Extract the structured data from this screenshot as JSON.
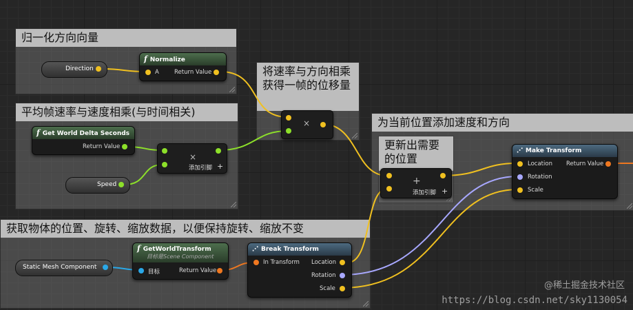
{
  "comments": {
    "normalize": "归一化方向向量",
    "delta": "平均帧速率与速度相乘(与时间相关)",
    "multiply": "将速率与方向相乘获得一帧的位移量",
    "add_dir": "为当前位置添加速度和方向",
    "update": "更新出需要的位置",
    "get_transform": "获取物体的位置、旋转、缩放数据，以便保持旋转、缩放不变"
  },
  "nodes": {
    "normalize": {
      "title": "Normalize",
      "in_a": "A",
      "out": "Return Value"
    },
    "delta": {
      "title": "Get World Delta Seconds",
      "out": "Return Value"
    },
    "get_world": {
      "title": "GetWorldTransform",
      "subtitle": "目标是Scene Component",
      "in_target": "目标",
      "out": "Return Value"
    },
    "break": {
      "title": "Break Transform",
      "in": "In Transform",
      "out_loc": "Location",
      "out_rot": "Rotation",
      "out_scale": "Scale"
    },
    "make": {
      "title": "Make Transform",
      "in_loc": "Location",
      "in_rot": "Rotation",
      "in_scale": "Scale",
      "out": "Return Value"
    }
  },
  "variables": {
    "direction": "Direction",
    "speed": "Speed",
    "static_mesh": "Static Mesh Component"
  },
  "ops": {
    "multiply_symbol": "×",
    "add_pin_label": "添加引脚",
    "plus_symbol": "+",
    "add_symbol": "+"
  },
  "watermark": {
    "line1": "@稀土掘金技术社区",
    "line2": "https://blog.csdn.net/sky1130054"
  },
  "colors": {
    "vector_pin": "#f0c020",
    "float_pin": "#8de02a",
    "object_pin": "#2aa8e8",
    "transform_pin": "#f07820",
    "rotator_pin": "#a8a8ff"
  }
}
